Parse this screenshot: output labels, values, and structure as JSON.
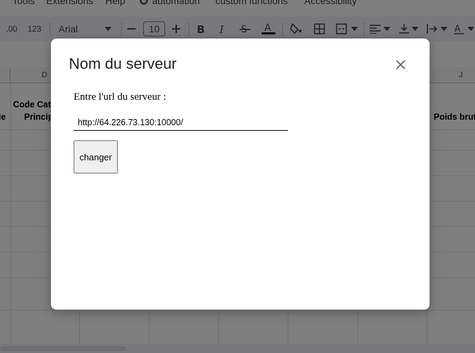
{
  "menubar": {
    "tools": "Tools",
    "extensions": "Extensions",
    "help": "Help",
    "automation": "automation",
    "custom_functions": "custom functions",
    "accessibility": "Accessibility"
  },
  "toolbar": {
    "decimal": ".00",
    "format_123": "123",
    "font": "Arial",
    "font_size": "10"
  },
  "columns": {
    "d": "D",
    "j": "J"
  },
  "cells": {
    "partial_left": "ie",
    "code_cat_line1": "Code Cat",
    "code_cat_line2": "Princip",
    "poids_brut": "Poids brut"
  },
  "dialog": {
    "title": "Nom du serveur",
    "label": "Entre l'url du serveur :",
    "url_value": "http://64.226.73.130:10000/",
    "button_label": "changer"
  },
  "colors": {
    "overlay": "rgba(0,0,0,0.5)",
    "toolbar_bg": "#edf2fa",
    "dialog_bg": "#ffffff"
  }
}
